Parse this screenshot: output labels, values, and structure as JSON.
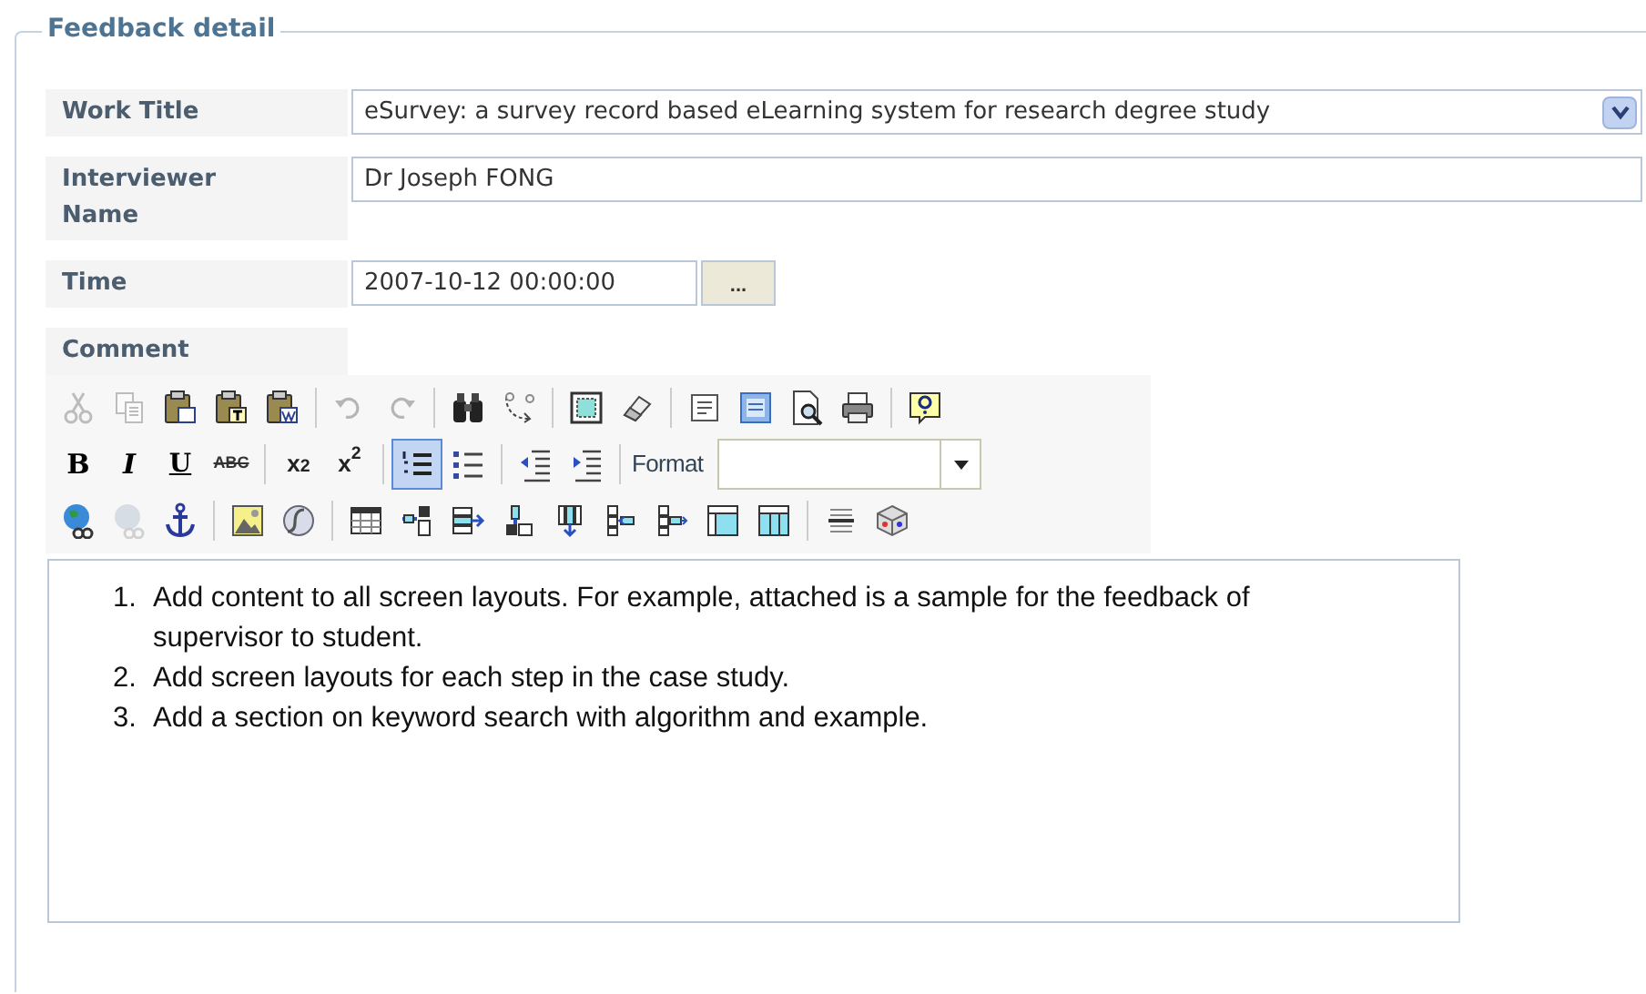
{
  "legend": "Feedback detail",
  "fields": [
    {
      "kind": "select",
      "label": "Work Title",
      "value": "eSurvey: a survey record based eLearning system for research degree study"
    },
    {
      "kind": "text",
      "label": "Interviewer Name",
      "value": "Dr Joseph FONG"
    },
    {
      "kind": "date",
      "label": "Time",
      "value": "2007-10-12 00:00:00",
      "button": "..."
    },
    {
      "kind": "heading",
      "label": "Comment"
    }
  ],
  "toolbar": [
    [
      {
        "kind": "icon",
        "disabled": true
      },
      {
        "kind": "icon",
        "disabled": true
      },
      {
        "kind": "icon",
        "disabled": false
      },
      {
        "kind": "icon",
        "disabled": false
      },
      {
        "kind": "icon",
        "disabled": false
      },
      {
        "kind": "separator"
      },
      {
        "kind": "icon",
        "disabled": true
      },
      {
        "kind": "icon",
        "disabled": true
      },
      {
        "kind": "separator"
      },
      {
        "kind": "icon",
        "disabled": false
      },
      {
        "kind": "icon",
        "disabled": false
      },
      {
        "kind": "separator"
      },
      {
        "kind": "icon",
        "disabled": false
      },
      {
        "kind": "icon",
        "disabled": false
      },
      {
        "kind": "separator"
      },
      {
        "kind": "icon",
        "disabled": false
      },
      {
        "kind": "icon",
        "disabled": false
      },
      {
        "kind": "icon",
        "disabled": false
      },
      {
        "kind": "icon",
        "disabled": false
      },
      {
        "kind": "separator"
      },
      {
        "kind": "icon",
        "disabled": false
      }
    ],
    [
      {
        "kind": "text",
        "label": "B",
        "selected": false
      },
      {
        "kind": "text",
        "label": "I",
        "selected": false
      },
      {
        "kind": "text",
        "label": "U",
        "selected": false
      },
      {
        "kind": "text",
        "label": "ABC",
        "selected": false
      },
      {
        "kind": "separator"
      },
      {
        "kind": "text",
        "label": "x$_{2}$",
        "selected": false
      },
      {
        "kind": "text",
        "label": "x$^{2}$",
        "selected": false
      },
      {
        "kind": "separator"
      },
      {
        "kind": "icon",
        "disabled": false,
        "selected": true
      },
      {
        "kind": "icon",
        "disabled": false,
        "selected": false
      },
      {
        "kind": "separator"
      },
      {
        "kind": "icon",
        "disabled": false
      },
      {
        "kind": "icon",
        "disabled": false
      },
      {
        "kind": "separator"
      },
      {
        "kind": "select",
        "label": "Format"
      }
    ],
    [
      {
        "kind": "icon",
        "disabled": false
      },
      {
        "kind": "icon",
        "disabled": true
      },
      {
        "kind": "icon",
        "disabled": false
      },
      {
        "kind": "separator"
      },
      {
        "kind": "icon",
        "disabled": false
      },
      {
        "kind": "icon",
        "disabled": false
      },
      {
        "kind": "separator"
      },
      {
        "kind": "icon",
        "disabled": false
      },
      {
        "kind": "icon",
        "disabled": false
      },
      {
        "kind": "icon",
        "disabled": false
      },
      {
        "kind": "icon",
        "disabled": false
      },
      {
        "kind": "icon",
        "disabled": false
      },
      {
        "kind": "icon",
        "disabled": false
      },
      {
        "kind": "icon",
        "disabled": false
      },
      {
        "kind": "icon",
        "disabled": false
      },
      {
        "kind": "icon",
        "disabled": false
      },
      {
        "kind": "separator"
      },
      {
        "kind": "icon",
        "disabled": false
      },
      {
        "kind": "icon",
        "disabled": false
      }
    ]
  ],
  "comment": [
    {
      "number": "1.",
      "text": "Add content to all screen layouts. For example, attached is a sample for the feedback of supervisor to student."
    },
    {
      "number": "2.",
      "text": "Add screen layouts for each step in the case study."
    },
    {
      "number": "3.",
      "text": "Add a section on keyword search with algorithm and example."
    }
  ]
}
